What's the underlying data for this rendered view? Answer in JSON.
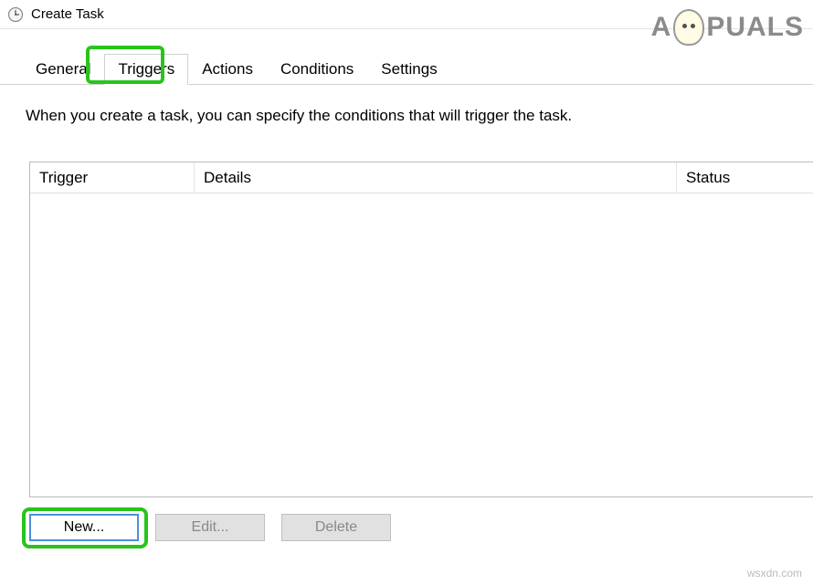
{
  "window": {
    "title": "Create Task"
  },
  "tabs": {
    "general": "General",
    "triggers": "Triggers",
    "actions": "Actions",
    "conditions": "Conditions",
    "settings": "Settings"
  },
  "panel": {
    "description": "When you create a task, you can specify the conditions that will trigger the task."
  },
  "table": {
    "columns": {
      "trigger": "Trigger",
      "details": "Details",
      "status": "Status"
    }
  },
  "buttons": {
    "new": "New...",
    "edit": "Edit...",
    "delete": "Delete"
  },
  "watermark": {
    "prefix": "A",
    "suffix": "PUALS",
    "site": "wsxdn.com"
  }
}
